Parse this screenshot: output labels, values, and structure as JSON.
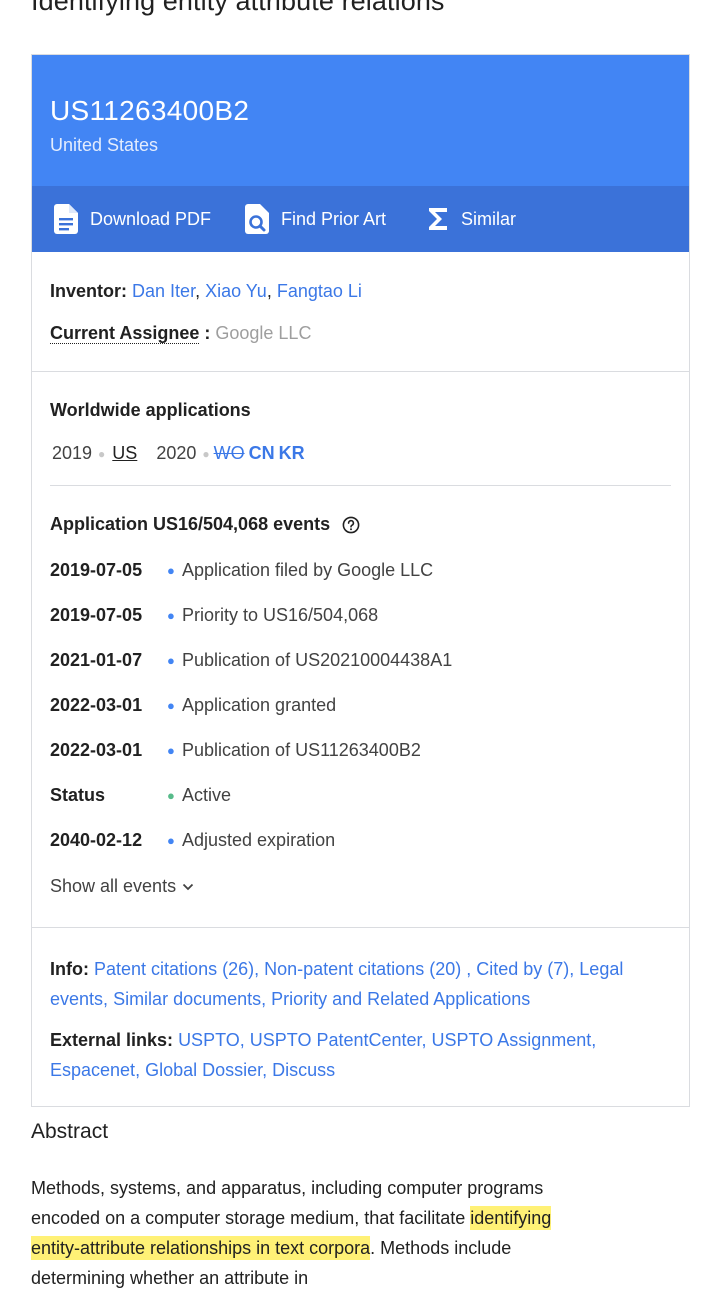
{
  "page": {
    "title": "Identifying entity attribute relations"
  },
  "header": {
    "patent_number": "US11263400B2",
    "country": "United States"
  },
  "toolbar": {
    "download_pdf": "Download PDF",
    "find_prior_art": "Find Prior Art",
    "similar": "Similar",
    "icons": [
      "document-icon",
      "search-document-icon",
      "sigma-icon"
    ]
  },
  "people": {
    "inventor_label": "Inventor:",
    "inventors": [
      "Dan Iter",
      "Xiao Yu",
      "Fangtao Li"
    ],
    "inventor_sep": ", ",
    "assignee_label": "Current Assignee",
    "assignee_colon": " : ",
    "assignee": "Google LLC"
  },
  "worldwide": {
    "heading": "Worldwide applications",
    "year1": "2019",
    "country1": "US",
    "year2": "2020",
    "country_wo": "WO",
    "country_cn": "CN",
    "country_kr": "KR"
  },
  "events": {
    "heading": "Application US16/504,068 events",
    "items": [
      {
        "date": "2019-07-05",
        "desc": "Application filed by Google LLC"
      },
      {
        "date": "2019-07-05",
        "desc": "Priority to US16/504,068"
      },
      {
        "date": "2021-01-07",
        "desc": "Publication of US20210004438A1"
      },
      {
        "date": "2022-03-01",
        "desc": "Application granted"
      },
      {
        "date": "2022-03-01",
        "desc": "Publication of US11263400B2"
      },
      {
        "date": "Status",
        "desc": "Active"
      },
      {
        "date": "2040-02-12",
        "desc": "Adjusted expiration"
      }
    ],
    "show_all": "Show all events",
    "colors": {
      "event_dot": "#4285f4",
      "active_dot": "#57bb8a"
    }
  },
  "info": {
    "label": "Info:",
    "links": [
      "Patent citations (26)",
      "Non-patent citations (20)",
      "Cited by (7)",
      "Legal events",
      "Similar documents",
      "Priority and Related Applications"
    ]
  },
  "external": {
    "label": "External links:",
    "links": [
      "USPTO",
      "USPTO PatentCenter",
      "USPTO Assignment",
      "Espacenet",
      "Global Dossier",
      "Discuss"
    ]
  },
  "abstract": {
    "title": "Abstract",
    "text_before": "Methods, systems, and apparatus, including computer programs encoded on a computer storage medium, that facilitate ",
    "highlight": "identifying entity-attribute relationships in text corpora",
    "text_after": ". Methods include determining whether an attribute in"
  },
  "colors": {
    "header_blue": "#4285f4",
    "toolbar_blue": "#3b72d9",
    "link_blue": "#3b78e7",
    "highlight_yellow": "#fff176"
  }
}
